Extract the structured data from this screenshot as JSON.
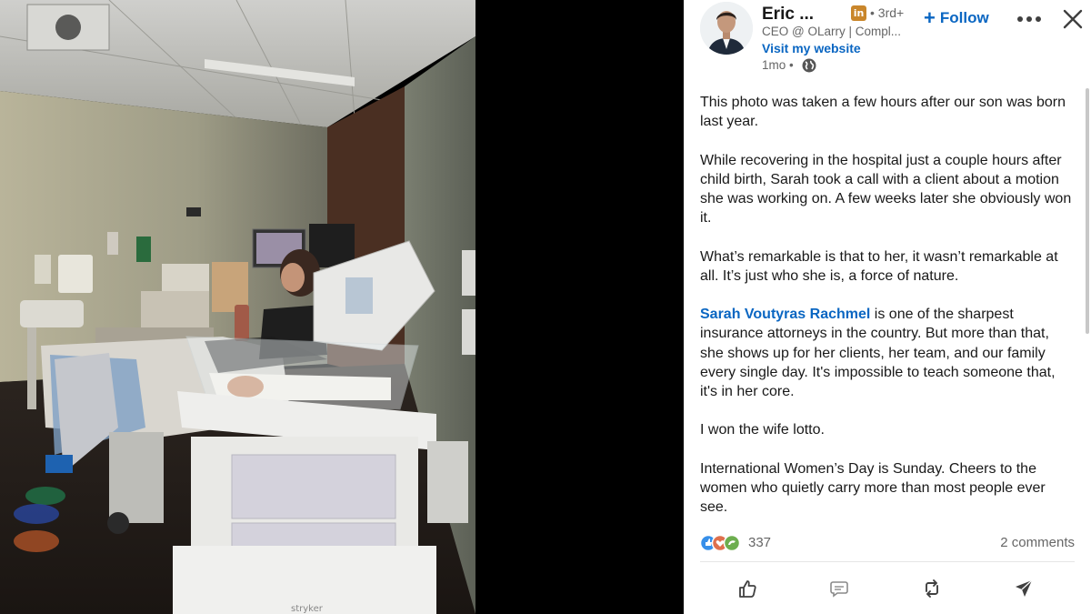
{
  "post": {
    "author": {
      "name": "Eric ...",
      "badge": "in",
      "degree": "• 3rd+",
      "headline": "CEO @ OLarry | Compl...",
      "website_label": "Visit my website",
      "timestamp": "1mo •"
    },
    "follow_label": "Follow",
    "paragraphs": [
      "This photo was taken a few hours after our son was born last year.",
      "While recovering in the hospital just a couple hours after child birth, Sarah took a call with a client about a motion she was working on. A few weeks later she obviously won it.",
      "What’s remarkable is that to her, it wasn’t remarkable at all. It’s just who she is, a force of nature."
    ],
    "mention": {
      "name": "Sarah Voutyras Rachmel",
      "rest": " is one of the sharpest insurance attorneys in the country. But more than that, she shows up for her clients, her team, and our family every single day. It's impossible to teach someone that, it's in her core."
    },
    "paragraphs_after": [
      "I won the wife lotto.",
      "International Women’s Day is Sunday. Cheers to the women who quietly carry more than most people ever see."
    ],
    "reactions": {
      "count": "337",
      "comments": "2 comments",
      "icons": [
        "like-icon",
        "love-icon",
        "support-icon"
      ]
    },
    "actions": [
      "like-action-icon",
      "comment-action-icon",
      "repost-action-icon",
      "send-action-icon"
    ]
  },
  "colors": {
    "link": "#0a66c2",
    "muted": "#666666",
    "badge": "#c9862b"
  }
}
